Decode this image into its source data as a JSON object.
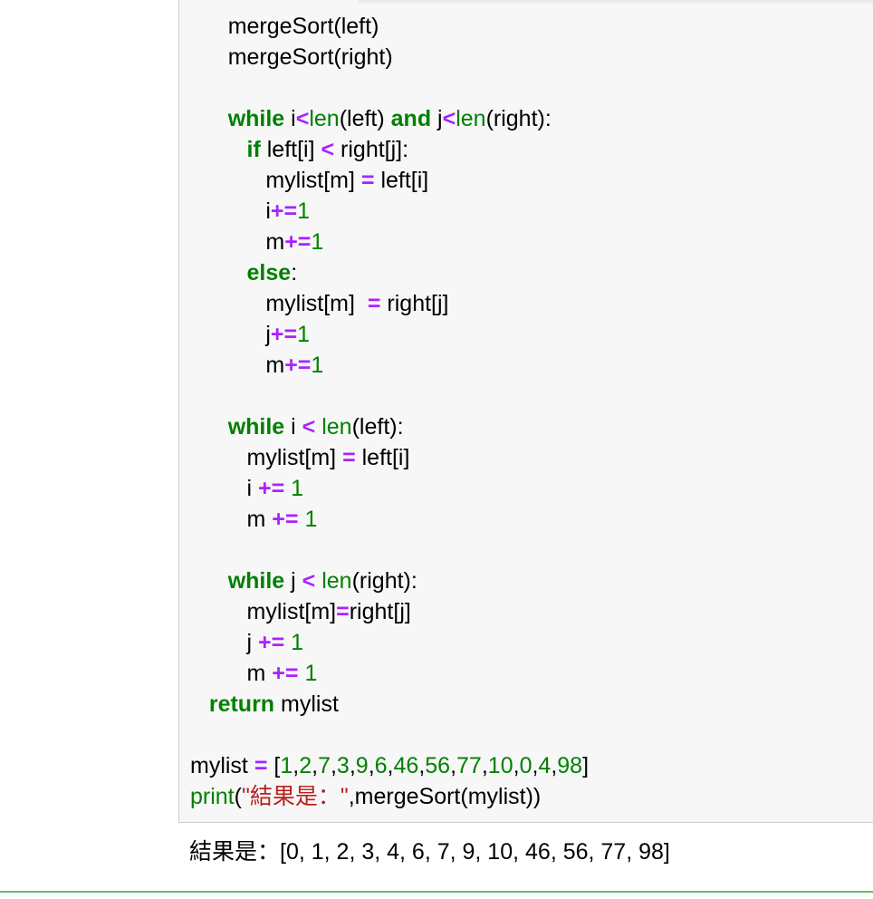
{
  "code_lines": [
    [
      {
        "t": "      ",
        "c": ""
      },
      {
        "t": "mergeSort(left)",
        "c": ""
      }
    ],
    [
      {
        "t": "      ",
        "c": ""
      },
      {
        "t": "mergeSort(right)",
        "c": ""
      }
    ],
    [],
    [
      {
        "t": "      ",
        "c": ""
      },
      {
        "t": "while",
        "c": "kw"
      },
      {
        "t": " i",
        "c": ""
      },
      {
        "t": "<",
        "c": "op"
      },
      {
        "t": "len",
        "c": "bi"
      },
      {
        "t": "(left) ",
        "c": ""
      },
      {
        "t": "and",
        "c": "kw"
      },
      {
        "t": " j",
        "c": ""
      },
      {
        "t": "<",
        "c": "op"
      },
      {
        "t": "len",
        "c": "bi"
      },
      {
        "t": "(right):",
        "c": ""
      }
    ],
    [
      {
        "t": "         ",
        "c": ""
      },
      {
        "t": "if",
        "c": "kw"
      },
      {
        "t": " left[i] ",
        "c": ""
      },
      {
        "t": "<",
        "c": "op"
      },
      {
        "t": " right[j]:",
        "c": ""
      }
    ],
    [
      {
        "t": "            ",
        "c": ""
      },
      {
        "t": "mylist[m] ",
        "c": ""
      },
      {
        "t": "=",
        "c": "op"
      },
      {
        "t": " left[i]",
        "c": ""
      }
    ],
    [
      {
        "t": "            ",
        "c": ""
      },
      {
        "t": "i",
        "c": ""
      },
      {
        "t": "+=",
        "c": "op"
      },
      {
        "t": "1",
        "c": "num"
      }
    ],
    [
      {
        "t": "            ",
        "c": ""
      },
      {
        "t": "m",
        "c": ""
      },
      {
        "t": "+=",
        "c": "op"
      },
      {
        "t": "1",
        "c": "num"
      }
    ],
    [
      {
        "t": "         ",
        "c": ""
      },
      {
        "t": "else",
        "c": "kw"
      },
      {
        "t": ":",
        "c": ""
      }
    ],
    [
      {
        "t": "            ",
        "c": ""
      },
      {
        "t": "mylist[m]  ",
        "c": ""
      },
      {
        "t": "=",
        "c": "op"
      },
      {
        "t": " right[j]",
        "c": ""
      }
    ],
    [
      {
        "t": "            ",
        "c": ""
      },
      {
        "t": "j",
        "c": ""
      },
      {
        "t": "+=",
        "c": "op"
      },
      {
        "t": "1",
        "c": "num"
      }
    ],
    [
      {
        "t": "            ",
        "c": ""
      },
      {
        "t": "m",
        "c": ""
      },
      {
        "t": "+=",
        "c": "op"
      },
      {
        "t": "1",
        "c": "num"
      }
    ],
    [],
    [
      {
        "t": "      ",
        "c": ""
      },
      {
        "t": "while",
        "c": "kw"
      },
      {
        "t": " i ",
        "c": ""
      },
      {
        "t": "<",
        "c": "op"
      },
      {
        "t": " ",
        "c": ""
      },
      {
        "t": "len",
        "c": "bi"
      },
      {
        "t": "(left):",
        "c": ""
      }
    ],
    [
      {
        "t": "         ",
        "c": ""
      },
      {
        "t": "mylist[m] ",
        "c": ""
      },
      {
        "t": "=",
        "c": "op"
      },
      {
        "t": " left[i]",
        "c": ""
      }
    ],
    [
      {
        "t": "         ",
        "c": ""
      },
      {
        "t": "i ",
        "c": ""
      },
      {
        "t": "+=",
        "c": "op"
      },
      {
        "t": " ",
        "c": ""
      },
      {
        "t": "1",
        "c": "num"
      }
    ],
    [
      {
        "t": "         ",
        "c": ""
      },
      {
        "t": "m ",
        "c": ""
      },
      {
        "t": "+=",
        "c": "op"
      },
      {
        "t": " ",
        "c": ""
      },
      {
        "t": "1",
        "c": "num"
      }
    ],
    [],
    [
      {
        "t": "      ",
        "c": ""
      },
      {
        "t": "while",
        "c": "kw"
      },
      {
        "t": " j ",
        "c": ""
      },
      {
        "t": "<",
        "c": "op"
      },
      {
        "t": " ",
        "c": ""
      },
      {
        "t": "len",
        "c": "bi"
      },
      {
        "t": "(right):",
        "c": ""
      }
    ],
    [
      {
        "t": "         ",
        "c": ""
      },
      {
        "t": "mylist[m]",
        "c": ""
      },
      {
        "t": "=",
        "c": "op"
      },
      {
        "t": "right[j]",
        "c": ""
      }
    ],
    [
      {
        "t": "         ",
        "c": ""
      },
      {
        "t": "j ",
        "c": ""
      },
      {
        "t": "+=",
        "c": "op"
      },
      {
        "t": " ",
        "c": ""
      },
      {
        "t": "1",
        "c": "num"
      }
    ],
    [
      {
        "t": "         ",
        "c": ""
      },
      {
        "t": "m ",
        "c": ""
      },
      {
        "t": "+=",
        "c": "op"
      },
      {
        "t": " ",
        "c": ""
      },
      {
        "t": "1",
        "c": "num"
      }
    ],
    [
      {
        "t": "   ",
        "c": ""
      },
      {
        "t": "return",
        "c": "kw"
      },
      {
        "t": " mylist",
        "c": ""
      }
    ],
    [],
    [
      {
        "t": "mylist ",
        "c": ""
      },
      {
        "t": "=",
        "c": "op"
      },
      {
        "t": " [",
        "c": ""
      },
      {
        "t": "1",
        "c": "num"
      },
      {
        "t": ",",
        "c": ""
      },
      {
        "t": "2",
        "c": "num"
      },
      {
        "t": ",",
        "c": ""
      },
      {
        "t": "7",
        "c": "num"
      },
      {
        "t": ",",
        "c": ""
      },
      {
        "t": "3",
        "c": "num"
      },
      {
        "t": ",",
        "c": ""
      },
      {
        "t": "9",
        "c": "num"
      },
      {
        "t": ",",
        "c": ""
      },
      {
        "t": "6",
        "c": "num"
      },
      {
        "t": ",",
        "c": ""
      },
      {
        "t": "46",
        "c": "num"
      },
      {
        "t": ",",
        "c": ""
      },
      {
        "t": "56",
        "c": "num"
      },
      {
        "t": ",",
        "c": ""
      },
      {
        "t": "77",
        "c": "num"
      },
      {
        "t": ",",
        "c": ""
      },
      {
        "t": "10",
        "c": "num"
      },
      {
        "t": ",",
        "c": ""
      },
      {
        "t": "0",
        "c": "num"
      },
      {
        "t": ",",
        "c": ""
      },
      {
        "t": "4",
        "c": "num"
      },
      {
        "t": ",",
        "c": ""
      },
      {
        "t": "98",
        "c": "num"
      },
      {
        "t": "]",
        "c": ""
      }
    ],
    [
      {
        "t": "print",
        "c": "bi"
      },
      {
        "t": "(",
        "c": ""
      },
      {
        "t": "\"結果是：\"",
        "c": "str"
      },
      {
        "t": ",mergeSort(mylist))",
        "c": ""
      }
    ]
  ],
  "output_text": "結果是：[0, 1, 2, 3, 4, 6, 7, 9, 10, 46, 56, 77, 98]"
}
